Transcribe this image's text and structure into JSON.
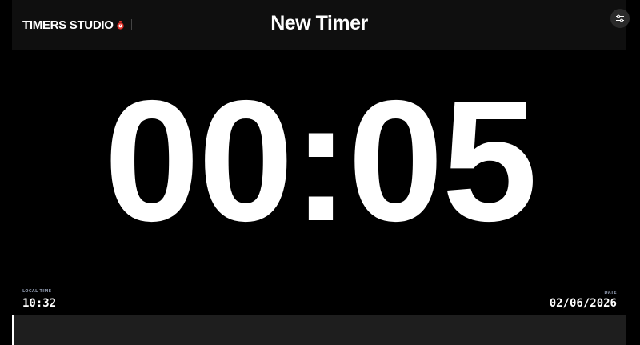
{
  "header": {
    "brand": "TIMERS STUDIO",
    "title": "New Timer",
    "settings_icon": "sliders-icon",
    "brand_logo_color": "#e4322b"
  },
  "timer": {
    "display": "00:05"
  },
  "footer": {
    "local_time_label": "LOCAL TIME",
    "local_time": "10:32",
    "date_label": "DATE",
    "date": "02/06/2026"
  },
  "progress": {
    "fraction": 0.003,
    "fill_color": "#ffffff",
    "track_color": "#1e1e1e"
  }
}
